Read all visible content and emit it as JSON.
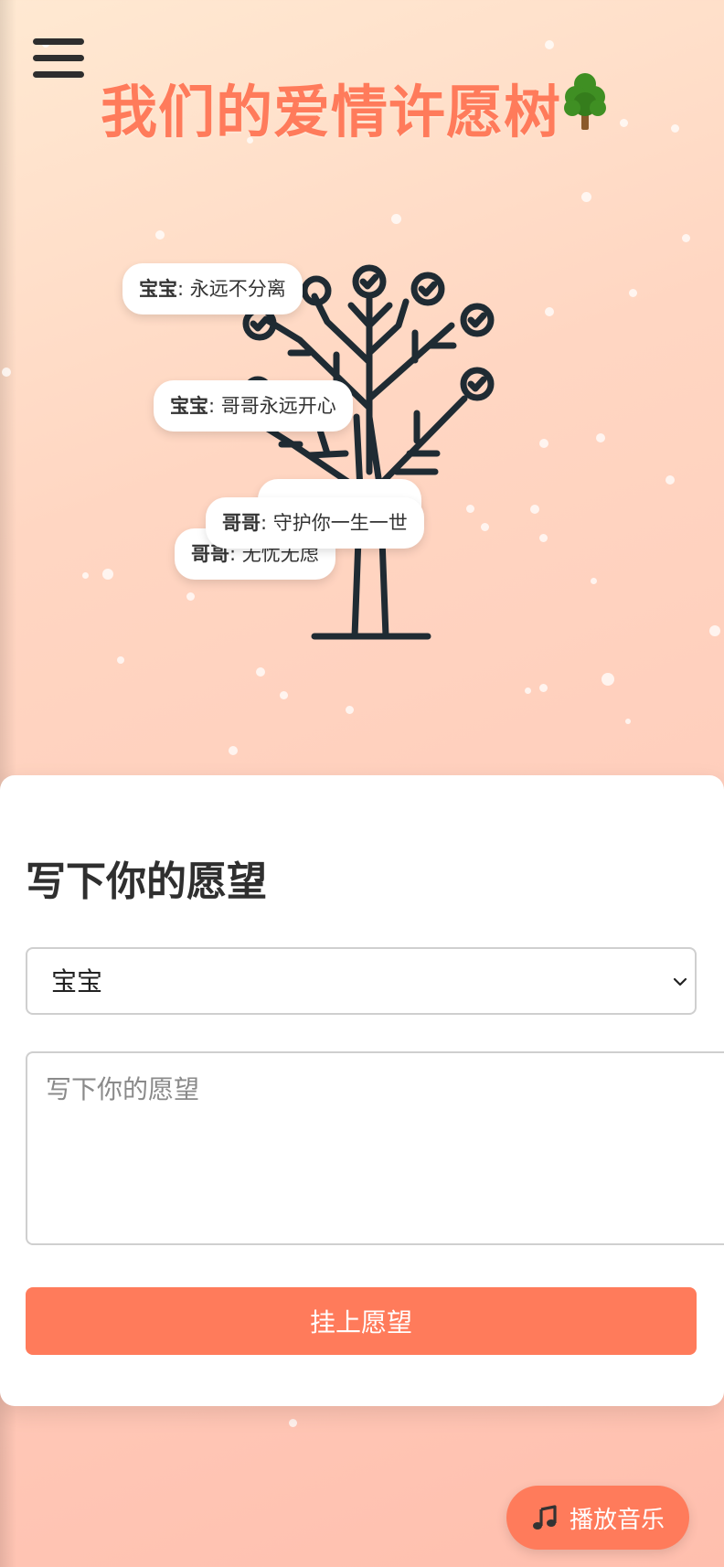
{
  "header": {
    "menu_icon": "hamburger-menu-icon",
    "title": "我们的爱情许愿树",
    "title_icon": "tree-icon"
  },
  "tree": {
    "icon": "wish-tree-icon",
    "wishes": [
      {
        "author": "宝宝",
        "text": ": 永远不分离"
      },
      {
        "author": "宝宝",
        "text": ": 哥哥永远开心"
      },
      {
        "author": "哥哥",
        "text": ": 无忧无虑"
      },
      {
        "author": "哥哥",
        "text": ": 守护你一生一世"
      }
    ]
  },
  "form": {
    "title": "写下你的愿望",
    "select_value": "宝宝",
    "textarea_placeholder": "写下你的愿望",
    "submit_label": "挂上愿望"
  },
  "music": {
    "icon": "music-note-icon",
    "label": "播放音乐"
  },
  "colors": {
    "accent": "#ff7b5b",
    "tree_line": "#1f2b33",
    "title_tree_green": "#3f8f23",
    "trunk_brown": "#8b5a2b"
  }
}
